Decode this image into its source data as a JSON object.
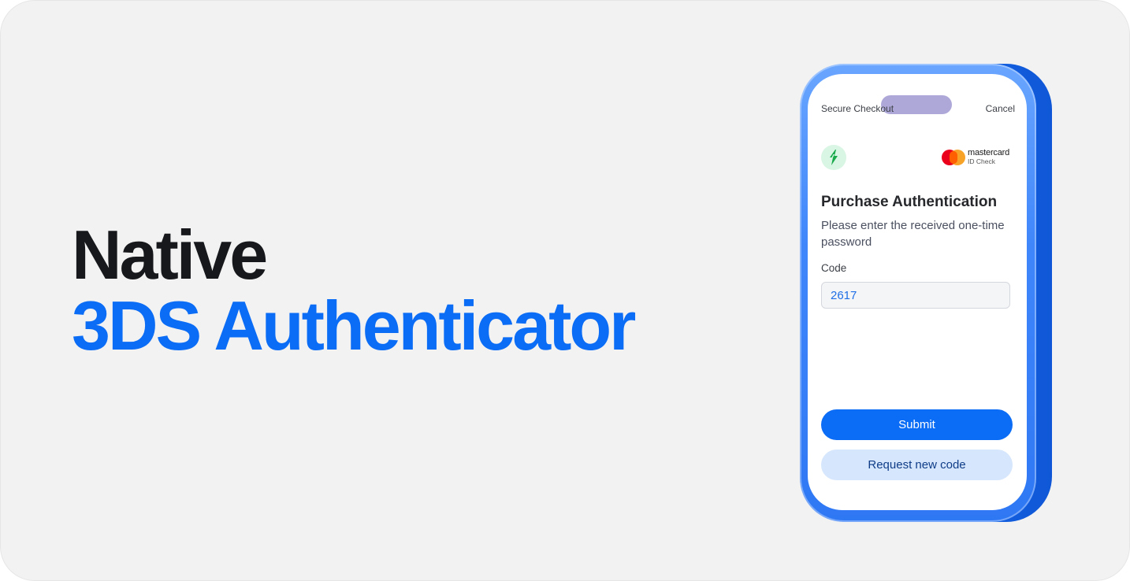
{
  "headline": {
    "line1": "Native",
    "line2": "3DS Authenticator"
  },
  "phone": {
    "topbar": {
      "title": "Secure Checkout",
      "cancel_label": "Cancel"
    },
    "mastercard": {
      "brand": "mastercard",
      "sub": "ID Check"
    },
    "form": {
      "title": "Purchase Authentication",
      "subtitle": "Please enter the received one-time password",
      "code_label": "Code",
      "code_value": "2617"
    },
    "actions": {
      "submit_label": "Submit",
      "request_label": "Request new code"
    }
  },
  "colors": {
    "accent": "#0b6cf5",
    "headline_dark": "#16181b",
    "background": "#f2f2f2",
    "merchant_green": "#18a94b"
  },
  "icons": {
    "merchant": "lightning-bolt-icon",
    "mastercard": "mastercard-logo-icon"
  }
}
